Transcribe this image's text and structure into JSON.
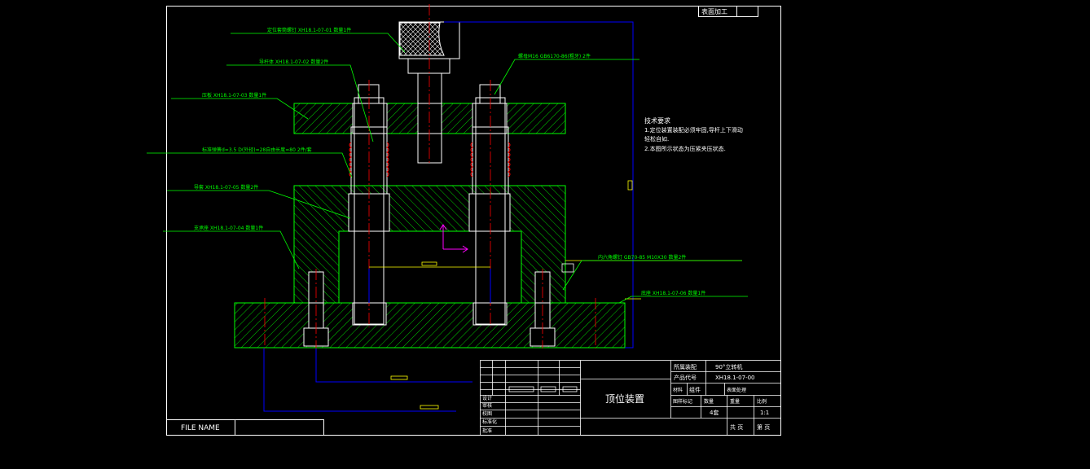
{
  "colors": {
    "background": "#000000",
    "frame": "#ffffff",
    "hatch": "#00ff00",
    "leader": "#00ff00",
    "centerline": "#ff0000",
    "hidden": "#0000ff",
    "ucs": "#ff00ff"
  },
  "surface_treatment": "表面加工",
  "callouts": [
    "定位套筒螺钉 XH18.1-07-01 数量1件",
    "导杆体 XH18.1-07-02 数量2件",
    "压板 XH18.1-07-03 数量1件",
    "标准弹簧d=3.5 D(外径)=28自由长度=80 2件/套",
    "导套 XH18.1-07-05 数量2件",
    "支承座 XH18.1-07-04 数量1件",
    "螺母M16 GB6170-86(粗牙) 2件",
    "内六角螺钉 GB70-85 M10X30 数量2件",
    "底座 XH18.1-07-06 数量1件"
  ],
  "tech_notes": {
    "title": "技术要求",
    "items": [
      "1.定位装置装配必须牢固,导杆上下滑动",
      "轻松自如.",
      "2.本图所示状态为压紧夹压状态."
    ]
  },
  "file_name_label": "FILE NAME",
  "title_block": {
    "drawing_name": "顶位装置",
    "assembly_label": "所属装配",
    "assembly_value": "90°立转机",
    "code_label": "产品代号",
    "code_value": "XH18.1-07-00",
    "material_label": "材料",
    "material_value": "组件",
    "surface_label": "表面处理",
    "mark_label": "图样标记",
    "qty_label": "数量",
    "weight_label": "重量",
    "scale_label": "比例",
    "sheet_count": "4套",
    "scale_value": "1:1",
    "total_sheets_label": "共  页",
    "sheet_no_label": "第  页",
    "roles": [
      "设计",
      "审核",
      "校图",
      "标准化",
      "批准"
    ]
  }
}
